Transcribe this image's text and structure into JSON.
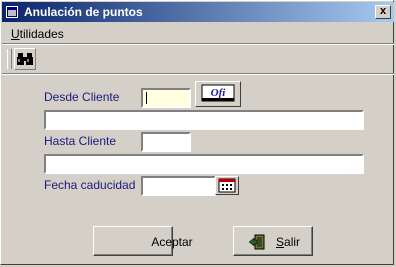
{
  "window": {
    "title": "Anulación de puntos",
    "close_label": "x",
    "title_bar_color": "#0a246a"
  },
  "menu": {
    "items": [
      {
        "label": "Utilidades",
        "accesskey": "U"
      }
    ]
  },
  "toolbar": {
    "buttons": [
      {
        "icon": "binoculars-icon"
      }
    ]
  },
  "form": {
    "desde_cliente_label": "Desde Cliente",
    "desde_cliente_value": "",
    "ofi_button_label": "Ofi",
    "desde_cliente_name": "",
    "hasta_cliente_label": "Hasta Cliente",
    "hasta_cliente_value": "",
    "hasta_cliente_name": "",
    "fecha_caducidad_label": "Fecha caducidad",
    "fecha_caducidad_value": "",
    "calendar_icon": "calendar-icon"
  },
  "actions": {
    "accept_label": "Aceptar",
    "exit_label": "Salir",
    "exit_accesskey": "S",
    "exit_icon": "exit-door-icon"
  },
  "colors": {
    "label_color": "#1a1a80",
    "active_field_bg": "#ffffe0",
    "face": "#d4d0c8"
  }
}
